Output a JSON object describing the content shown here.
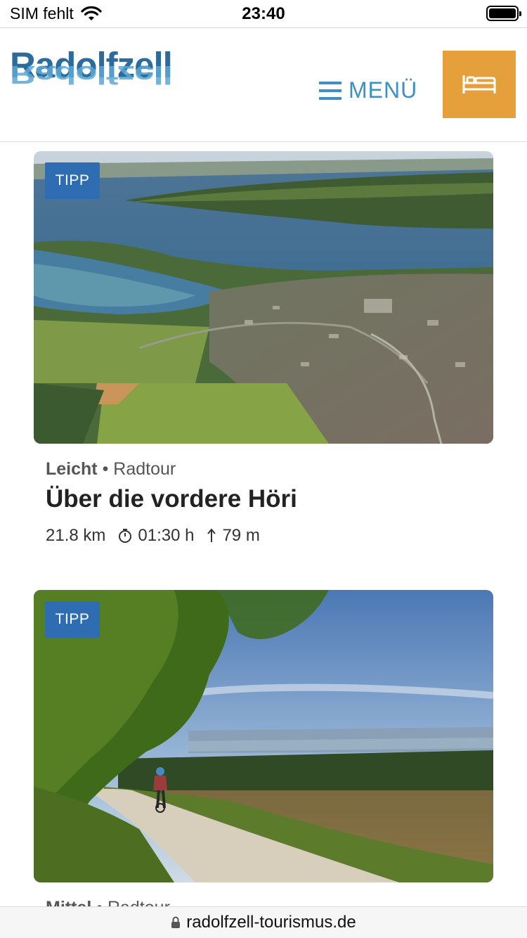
{
  "status_bar": {
    "carrier": "SIM fehlt",
    "time": "23:40",
    "wifi_icon": "wifi-icon",
    "battery_icon": "battery-icon"
  },
  "header": {
    "logo_text": "Radolfzell",
    "menu_label": "MENÜ",
    "menu_icon": "hamburger-icon",
    "booking_icon": "bed-icon",
    "colors": {
      "brand_blue": "#2c6c9c",
      "menu_blue": "#3d8fc4",
      "booking_orange": "#e6a03b"
    }
  },
  "tours": [
    {
      "badge": "TIPP",
      "difficulty": "Leicht",
      "separator": "•",
      "category": "Radtour",
      "title": "Über die vordere Höri",
      "distance": "21.8 km",
      "duration": "01:30 h",
      "ascent": "79 m",
      "image": "aerial-lake-town-photo"
    },
    {
      "badge": "TIPP",
      "difficulty": "Mittel",
      "separator": "•",
      "category": "Radtour",
      "image": "cyclist-gravel-path-photo"
    }
  ],
  "url_bar": {
    "url": "radolfzell-tourismus.de",
    "lock_icon": "lock-icon"
  },
  "badge_color": "#2f6db3"
}
